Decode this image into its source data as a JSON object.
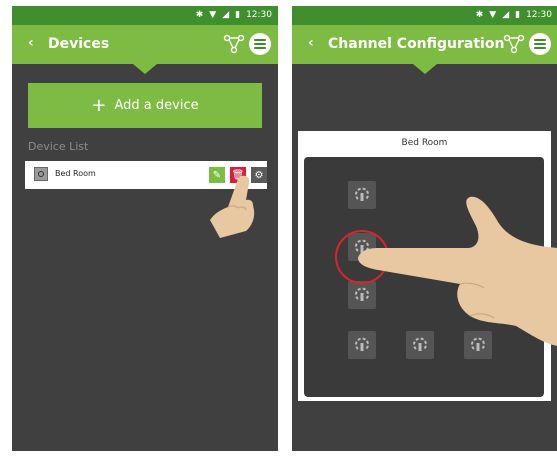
{
  "status_bar": {
    "time": "12:30"
  },
  "devices_screen": {
    "title": "Devices",
    "add_button_label": "Add a device",
    "section_label": "Device List",
    "devices": [
      {
        "name": "Bed Room"
      }
    ]
  },
  "channel_screen": {
    "title": "Channel Configuration",
    "panel_title": "Bed Room",
    "channels": 6
  },
  "colors": {
    "status_bar": "#3f8f2e",
    "app_bar": "#7dbb42",
    "background": "#404040",
    "edit": "#7dbb42",
    "delete": "#d81e3a",
    "highlight": "#d9232e"
  }
}
